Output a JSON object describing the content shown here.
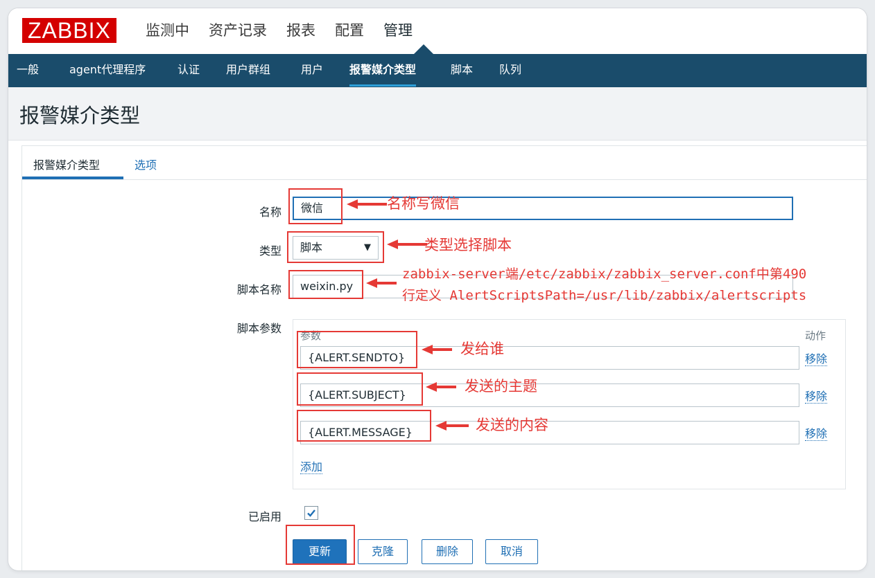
{
  "app": {
    "logo": "ZABBIX"
  },
  "main_menu": [
    "监测中",
    "资产记录",
    "报表",
    "配置",
    "管理"
  ],
  "sub_menu": [
    "一般",
    "agent代理程序",
    "认证",
    "用户群组",
    "用户",
    "报警媒介类型",
    "脚本",
    "队列"
  ],
  "page": {
    "title": "报警媒介类型"
  },
  "tabs": {
    "main": "报警媒介类型",
    "options": "选项"
  },
  "form": {
    "name_label": "名称",
    "name_value": "微信",
    "type_label": "类型",
    "type_value": "脚本",
    "script_name_label": "脚本名称",
    "script_name_value": "weixin.py",
    "script_params_label": "脚本参数",
    "params_header": "参数",
    "action_header": "动作",
    "params": [
      {
        "value": "{ALERT.SENDTO}",
        "remove": "移除"
      },
      {
        "value": "{ALERT.SUBJECT}",
        "remove": "移除"
      },
      {
        "value": "{ALERT.MESSAGE}",
        "remove": "移除"
      }
    ],
    "add_link": "添加",
    "enabled_label": "已启用",
    "enabled": true
  },
  "buttons": {
    "update": "更新",
    "clone": "克隆",
    "delete": "删除",
    "cancel": "取消"
  },
  "annotations": {
    "name": "名称写微信",
    "type": "类型选择脚本",
    "script_line1": "zabbix-server端/etc/zabbix/zabbix_server.conf中第490",
    "script_line2": "行定义 AlertScriptsPath=/usr/lib/zabbix/alertscripts",
    "sendto": "发给谁",
    "subject": "发送的主题",
    "message": "发送的内容"
  },
  "colors": {
    "logo_red": "#d40000",
    "nav_blue": "#1a4c6b",
    "link_blue": "#1f6fb4",
    "annotation_red": "#e53935"
  }
}
